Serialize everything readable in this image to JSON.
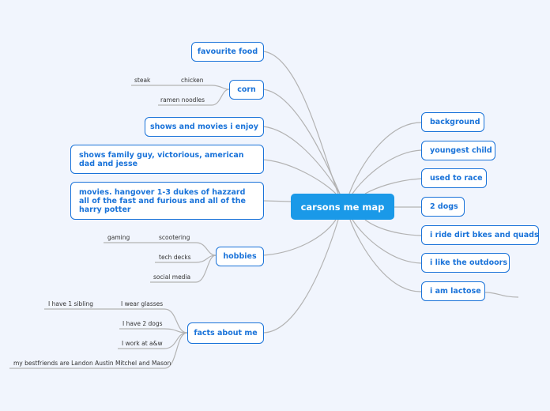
{
  "central": {
    "label": "carsons me map"
  },
  "left_topics": [
    {
      "id": "favourite-food",
      "label": "favourite food"
    },
    {
      "id": "corn",
      "label": "corn",
      "children": [
        "steak",
        "chicken",
        "ramen noodles"
      ]
    },
    {
      "id": "shows-and-movies",
      "label": "shows and movies i enjoy"
    },
    {
      "id": "shows",
      "label": "shows   family guy, victorious, american dad and jesse"
    },
    {
      "id": "movies",
      "label": "movies. hangover 1-3 dukes of hazzard all of the fast and furious and all of the harry potter"
    },
    {
      "id": "hobbies",
      "label": "hobbies",
      "children": [
        "gaming",
        "scootering",
        "tech decks",
        "social media"
      ]
    },
    {
      "id": "facts-about-me",
      "label": "facts about me",
      "children": [
        "I have 1 sibling",
        "I wear glasses",
        "I have 2 dogs",
        "I work at a&w",
        "my bestfriends are Landon Austin Mitchel and Mason"
      ]
    }
  ],
  "right_topics": [
    {
      "id": "background",
      "label": "background"
    },
    {
      "id": "youngest-child",
      "label": "youngest child"
    },
    {
      "id": "used-to-race",
      "label": "used to race"
    },
    {
      "id": "2-dogs",
      "label": "2 dogs"
    },
    {
      "id": "dirt-bikes",
      "label": "i ride dirt bkes and quads"
    },
    {
      "id": "outdoors",
      "label": "i like the outdoors"
    },
    {
      "id": "lactose",
      "label": "i am lactose"
    }
  ],
  "colors": {
    "accent": "#1a73d9",
    "central_fill": "#1a99e8",
    "line": "#b0b0b0",
    "background": "#f1f5fd"
  }
}
